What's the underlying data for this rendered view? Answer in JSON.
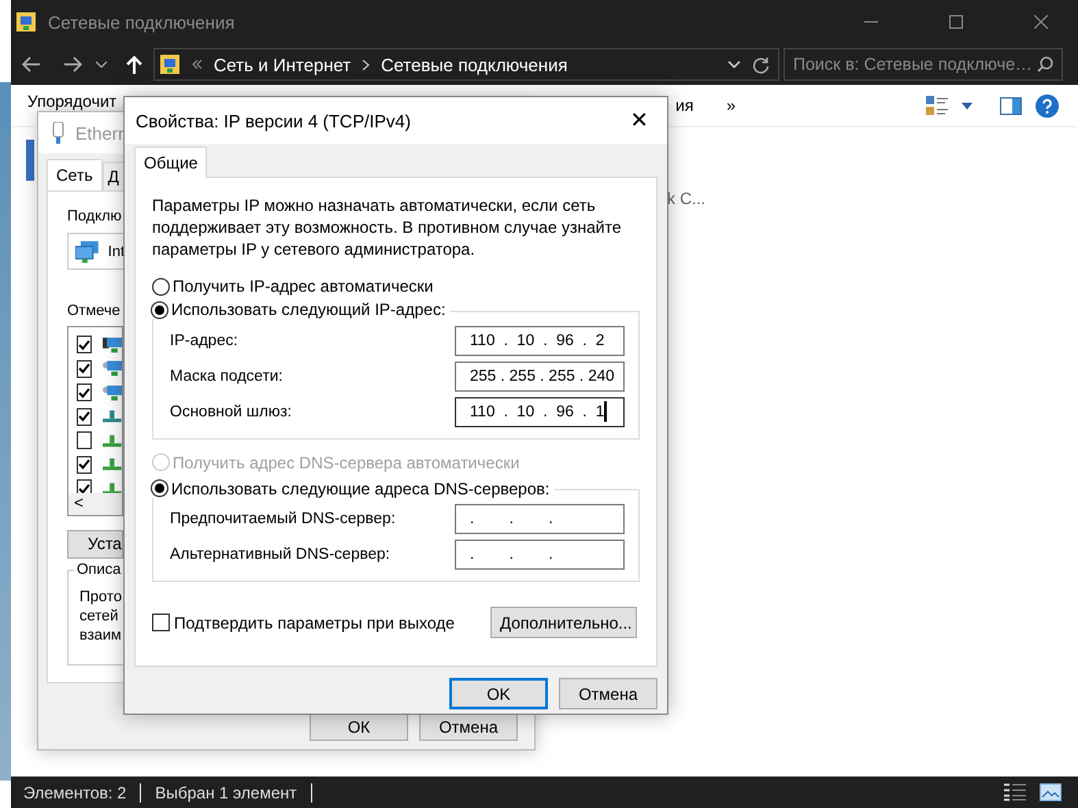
{
  "explorer": {
    "title": "Сетевые подключения",
    "breadcrumb": [
      {
        "label": "Сеть и Интернет"
      },
      {
        "label": "Сетевые подключения"
      }
    ],
    "search": {
      "placeholder": "Поиск в: Сетевые подключе…"
    },
    "toolbar": {
      "left_label": "Упорядочит",
      "mid_label": "ия",
      "more": "»"
    },
    "content_label": "k C...",
    "status_bar": [
      "Элементов: 2",
      "Выбран 1 элемент"
    ]
  },
  "ethernet_dialog": {
    "title": "Ethern",
    "tabs": [
      {
        "label": "Сеть",
        "selected": true
      },
      {
        "label": "Д",
        "selected": false
      }
    ],
    "connect_label": "Подклю",
    "adapter_label": "Int",
    "components_label": "Отмече",
    "components": [
      {
        "kind": "monitor",
        "checked": true
      },
      {
        "kind": "monitor-gear",
        "checked": true
      },
      {
        "kind": "monitor-gear",
        "checked": true
      },
      {
        "kind": "teal-network",
        "checked": true
      },
      {
        "kind": "green-network",
        "checked": false
      },
      {
        "kind": "green-network",
        "checked": true
      },
      {
        "kind": "green-network",
        "checked": true
      }
    ],
    "scroll_arrow": "<",
    "install_button": "Уста",
    "description_title": "Описа",
    "description_lines": [
      "Прото",
      "сетей",
      "взаим"
    ],
    "buttons": [
      "ОК",
      "Отмена"
    ]
  },
  "ipv4_dialog": {
    "title": "Свойства: IP версии 4 (TCP/IPv4)",
    "close": "✕",
    "tabs": [
      {
        "label": "Общие",
        "selected": true
      }
    ],
    "intro": "Параметры IP можно назначать автоматически, если сеть поддерживает эту возможность. В противном случае узнайте параметры IP у сетевого администратора.",
    "ip_mode": [
      {
        "label": "Получить IP-адрес автоматически",
        "selected": false,
        "disabled": false
      },
      {
        "label": "Использовать следующий IP-адрес:",
        "selected": true,
        "disabled": false
      }
    ],
    "ip_fields": [
      {
        "label": "IP-адрес:",
        "value": "110  .  10  .  96  .  2",
        "focused": false
      },
      {
        "label": "Маска подсети:",
        "value": "255 . 255 . 255 . 240",
        "focused": false
      },
      {
        "label": "Основной шлюз:",
        "value": "110  .  10  .  96  .  1",
        "focused": true
      }
    ],
    "dns_mode": [
      {
        "label": "Получить адрес DNS-сервера автоматически",
        "selected": false,
        "disabled": true
      },
      {
        "label": "Использовать следующие адреса DNS-серверов:",
        "selected": true,
        "disabled": false
      }
    ],
    "dns_fields": [
      {
        "label": "Предпочитаемый DNS-сервер:",
        "value": ".        .        .",
        "focused": false
      },
      {
        "label": "Альтернативный DNS-сервер:",
        "value": ".        .        .",
        "focused": false
      }
    ],
    "validate": {
      "label": "Подтвердить параметры при выходе",
      "checked": false
    },
    "advanced_button": "Дополнительно...",
    "buttons": [
      {
        "label": "OK",
        "default": true
      },
      {
        "label": "Отмена",
        "default": false
      }
    ]
  }
}
